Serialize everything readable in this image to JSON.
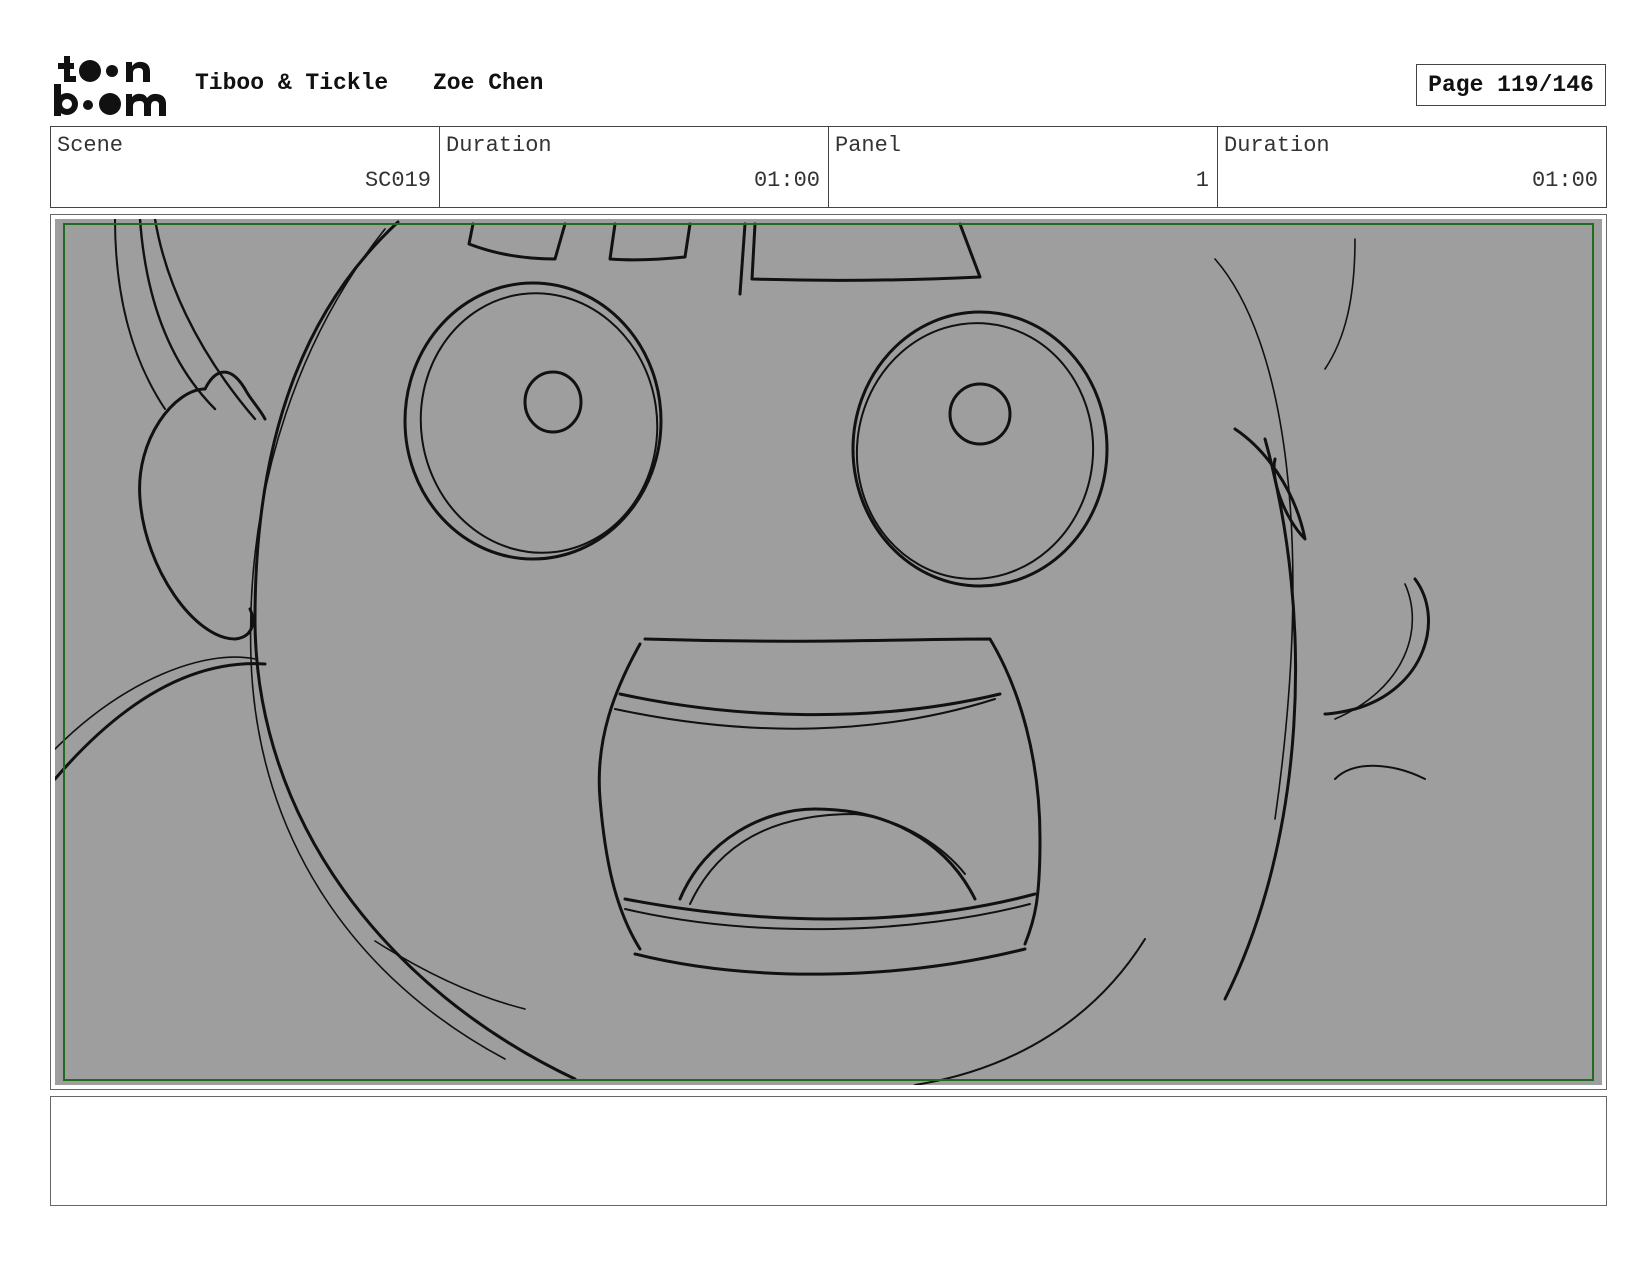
{
  "header": {
    "logo_icon": "toon-boom-logo",
    "project_title": "Tiboo & Tickle",
    "author": "Zoe Chen",
    "page_label": "Page 119/146"
  },
  "info": {
    "scene_label": "Scene",
    "scene_value": "SC019",
    "scene_duration_label": "Duration",
    "scene_duration_value": "01:00",
    "panel_label": "Panel",
    "panel_value": "1",
    "panel_duration_label": "Duration",
    "panel_duration_value": "01:00"
  },
  "panel": {
    "image_icon": "storyboard-sketch-surprised-face",
    "background_color": "#9e9e9e",
    "safe_frame_color": "#1f6b22"
  },
  "notes": {
    "text": ""
  }
}
